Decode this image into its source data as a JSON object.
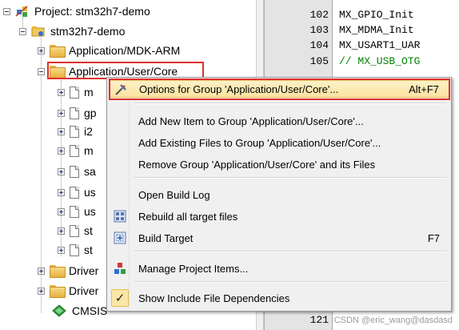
{
  "tree": {
    "project_label": "Project: stm32h7-demo",
    "target_label": "stm32h7-demo",
    "groups": [
      {
        "label": "Application/MDK-ARM",
        "expanded": false
      },
      {
        "label": "Application/User/Core",
        "expanded": true
      }
    ],
    "files": [
      "m",
      "gp",
      "i2",
      "m",
      "sa",
      "us",
      "us",
      "st",
      "st"
    ],
    "bottom_groups": [
      {
        "label": "Driver"
      },
      {
        "label": "Driver"
      }
    ],
    "cmsis_label": "CMSIS"
  },
  "editor": {
    "lines": [
      {
        "num": "102",
        "text": "MX_GPIO_Init",
        "kind": "plain"
      },
      {
        "num": "103",
        "text": "MX_MDMA_Init",
        "kind": "plain"
      },
      {
        "num": "104",
        "text": "MX_USART1_UAR",
        "kind": "plain"
      },
      {
        "num": "105",
        "text": "// MX_USB_OTG",
        "kind": "comment"
      },
      {
        "num": "121",
        "text": "",
        "kind": "plain"
      }
    ]
  },
  "context_menu": {
    "items": [
      {
        "label": "Options for Group 'Application/User/Core'...",
        "shortcut": "Alt+F7",
        "icon": "options-wand-icon",
        "selected": true
      },
      {
        "label": "Add New  Item to Group 'Application/User/Core'...",
        "shortcut": "",
        "icon": ""
      },
      {
        "label": "Add Existing Files to Group 'Application/User/Core'...",
        "shortcut": "",
        "icon": ""
      },
      {
        "label": "Remove Group 'Application/User/Core' and its Files",
        "shortcut": "",
        "icon": ""
      },
      {
        "label": "Open Build Log",
        "shortcut": "",
        "icon": ""
      },
      {
        "label": "Rebuild all target files",
        "shortcut": "",
        "icon": "rebuild-icon"
      },
      {
        "label": "Build Target",
        "shortcut": "F7",
        "icon": "build-icon"
      },
      {
        "label": "Manage Project Items...",
        "shortcut": "",
        "icon": "manage-items-icon"
      },
      {
        "label": "Show Include File Dependencies",
        "shortcut": "",
        "icon": "checkmark-icon",
        "checked": true
      }
    ]
  },
  "watermark": "CSDN @eric_wang@dasdasd",
  "colors": {
    "highlight_border": "#e03030",
    "comment": "#008000",
    "menu_selected": "#fbe3a0"
  }
}
